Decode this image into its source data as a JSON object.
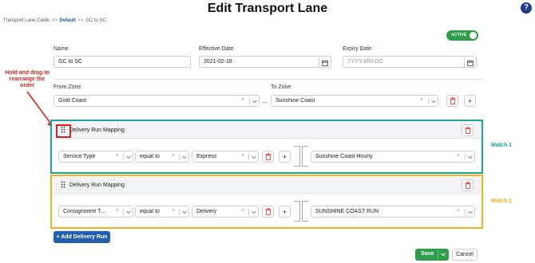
{
  "header": {
    "title": "Edit Transport Lane",
    "help_icon": "question-circle-icon",
    "help_symbol": "?"
  },
  "breadcrumb": {
    "root": "Transport Lane Cards",
    "sep": ">>",
    "current_link": "Default",
    "page": "GC to SC"
  },
  "status_toggle": {
    "label": "ACTIVE",
    "on": true,
    "color": "#2e9e4b"
  },
  "form": {
    "name_label": "Name",
    "name_value": "GC to SC",
    "effective_label": "Effective Date",
    "effective_value": "2021-02-18",
    "expiry_label": "Expiry Date",
    "expiry_placeholder": "YYYY-MM-DD",
    "from_zone_label": "From Zone",
    "from_zone_value": "Gold Coast",
    "range_sep": "—",
    "to_zone_label": "To Zone",
    "to_zone_value": "Sunshine Coast"
  },
  "annotation": {
    "text": "Hold and drag to rearrange the order",
    "color": "#d9231c"
  },
  "cards": [
    {
      "title": "Delivery Run Mapping",
      "field": "Service Type",
      "operator": "equal to",
      "value": "Express",
      "result": "Sunshine Coast Hourly",
      "match_label": "Match 1",
      "border_color": "#1aa39a"
    },
    {
      "title": "Delivery Run Mapping",
      "field": "Consignment T...",
      "operator": "equal to",
      "value": "Delivery",
      "result": "SUNSHINE COAST RUN",
      "match_label": "Match 2",
      "border_color": "#f0b21e"
    }
  ],
  "buttons": {
    "add_run": "+ Add Delivery Run",
    "save": "Save",
    "cancel": "Cancel"
  },
  "glyphs": {
    "clear": "×",
    "plus": "+"
  }
}
